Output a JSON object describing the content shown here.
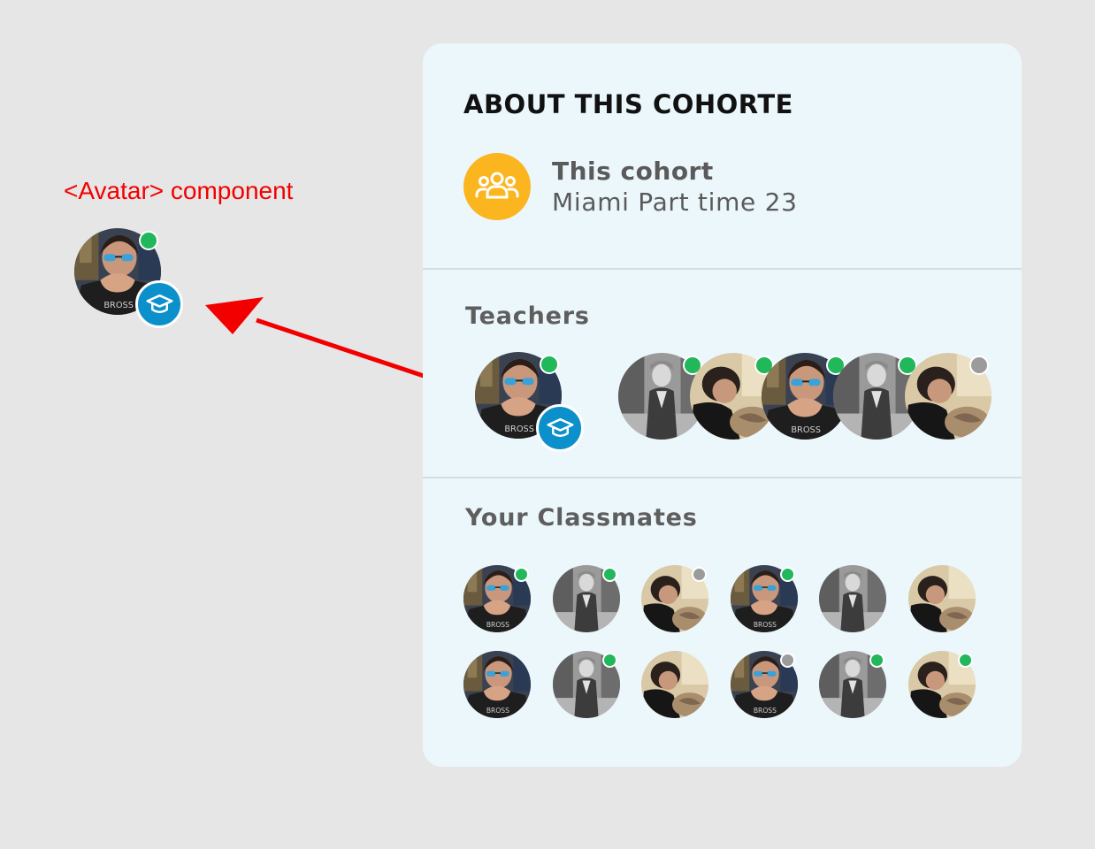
{
  "annotation": {
    "label": "<Avatar> component",
    "color": "#f20000"
  },
  "card": {
    "title": "ABOUT THIS COHORTE",
    "cohort": {
      "icon": "users-group-icon",
      "icon_color": "#fbb51f",
      "label": "This cohort",
      "name": "Miami Part time 23"
    },
    "teachers": {
      "title": "Teachers",
      "featured": {
        "photo": "glasses-man",
        "status": "online",
        "role": "teacher"
      },
      "group": [
        {
          "photo": "bw-woman",
          "status": "online"
        },
        {
          "photo": "man-dark",
          "status": "online"
        },
        {
          "photo": "glasses-man",
          "status": "online"
        },
        {
          "photo": "bw-woman",
          "status": "online"
        },
        {
          "photo": "man-dark",
          "status": "offline"
        }
      ]
    },
    "classmates": {
      "title": "Your Classmates",
      "rows": [
        [
          {
            "photo": "glasses-man",
            "status": "online"
          },
          {
            "photo": "bw-woman",
            "status": "online"
          },
          {
            "photo": "man-dark",
            "status": "offline"
          },
          {
            "photo": "glasses-man",
            "status": "online"
          },
          {
            "photo": "bw-woman",
            "status": "none"
          },
          {
            "photo": "man-dark",
            "status": "none"
          }
        ],
        [
          {
            "photo": "glasses-man",
            "status": "none"
          },
          {
            "photo": "bw-woman",
            "status": "online"
          },
          {
            "photo": "man-dark",
            "status": "none"
          },
          {
            "photo": "glasses-man",
            "status": "offline"
          },
          {
            "photo": "bw-woman",
            "status": "online"
          },
          {
            "photo": "man-dark",
            "status": "online"
          }
        ]
      ]
    }
  },
  "example_avatar": {
    "photo": "glasses-man",
    "status": "online",
    "role": "teacher"
  },
  "colors": {
    "online": "#21b75b",
    "offline": "#9b9b9b",
    "teacher_badge": "#0b90cc",
    "card_background": "#ecf7fc",
    "page_background": "#e6e6e6"
  },
  "icons": {
    "teacher_badge": "graduation-cap-icon",
    "cohort": "users-group-icon"
  }
}
